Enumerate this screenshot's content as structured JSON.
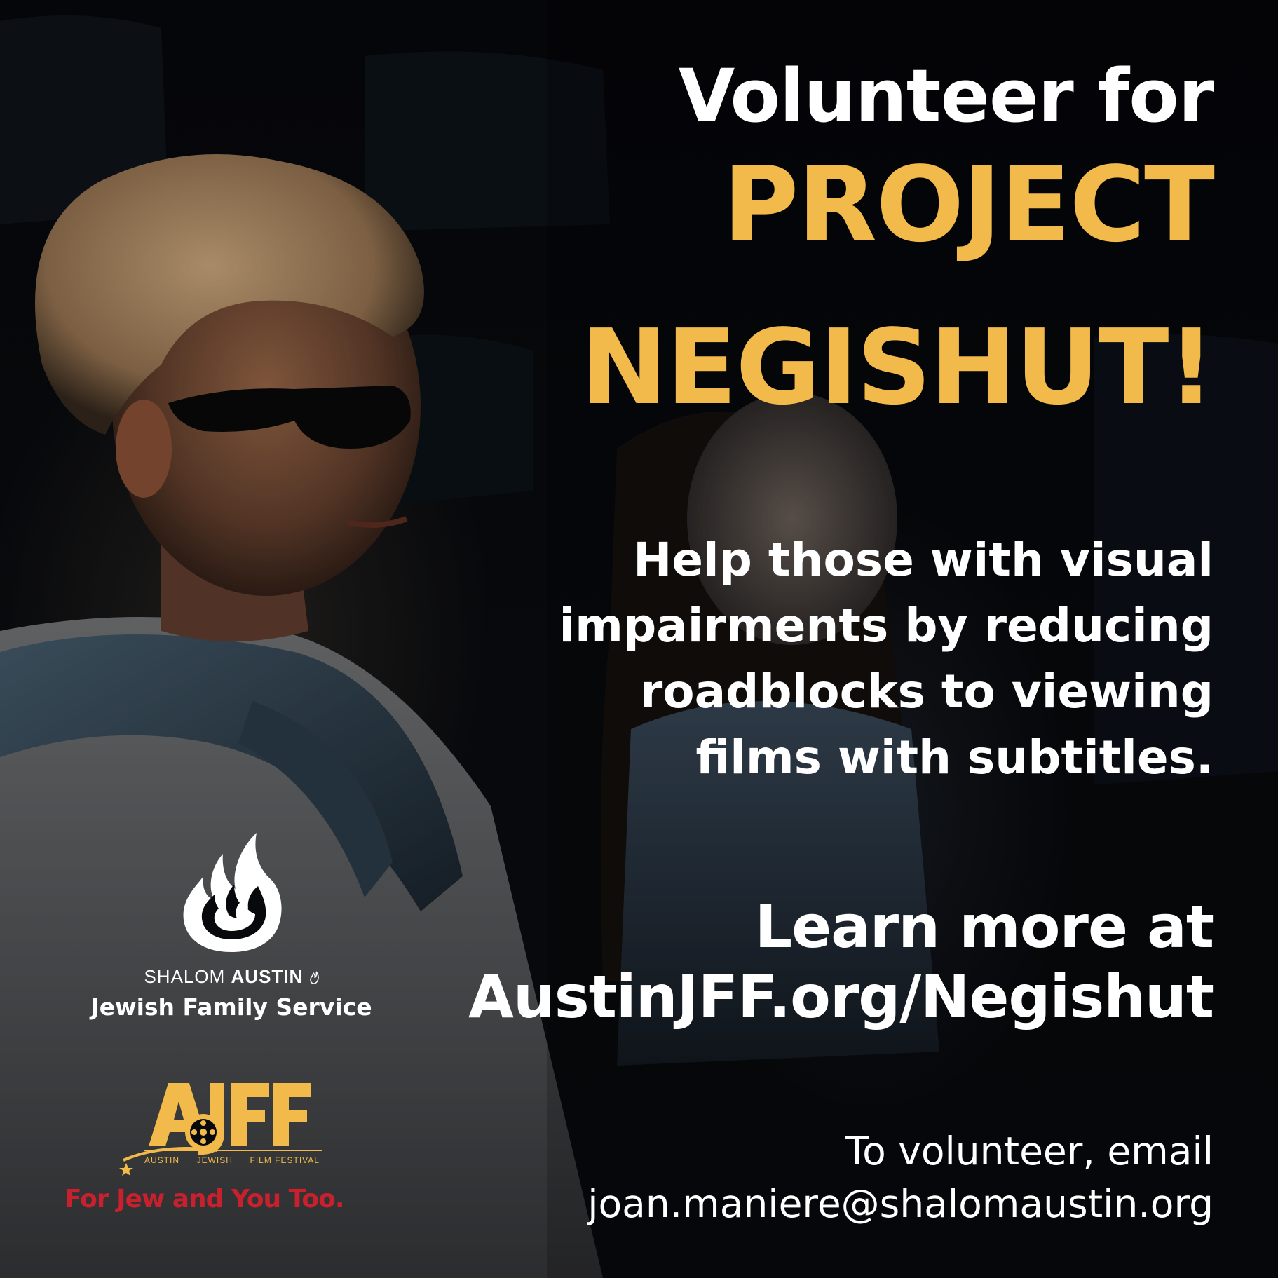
{
  "headline": {
    "line1": "Volunteer for",
    "line2": "PROJECT",
    "line3": "NEGISHUT!"
  },
  "body": {
    "lines": [
      "Help those with visual",
      "impairments by reducing",
      "roadblocks to viewing",
      "films with subtitles."
    ]
  },
  "learn_more": {
    "line1": "Learn more at",
    "url": "AustinJFF.org/Negishut"
  },
  "volunteer": {
    "line1": "To volunteer, email",
    "email": "joan.maniere@shalomaustin.org"
  },
  "jfs_logo": {
    "org_light": "SHALOM",
    "org_heavy": "AUSTIN",
    "name": "Jewish Family Service",
    "icon": "flame-icon"
  },
  "ajff_logo": {
    "wordmark": "AJFF",
    "sub_words": [
      "AUSTIN",
      "JEWISH",
      "FILM FESTIVAL"
    ],
    "tagline": "For Jew and You Too."
  },
  "colors": {
    "accent_gold": "#f2b94b",
    "tagline_red": "#c8202d",
    "text_white": "#ffffff",
    "background": "#07090d"
  }
}
